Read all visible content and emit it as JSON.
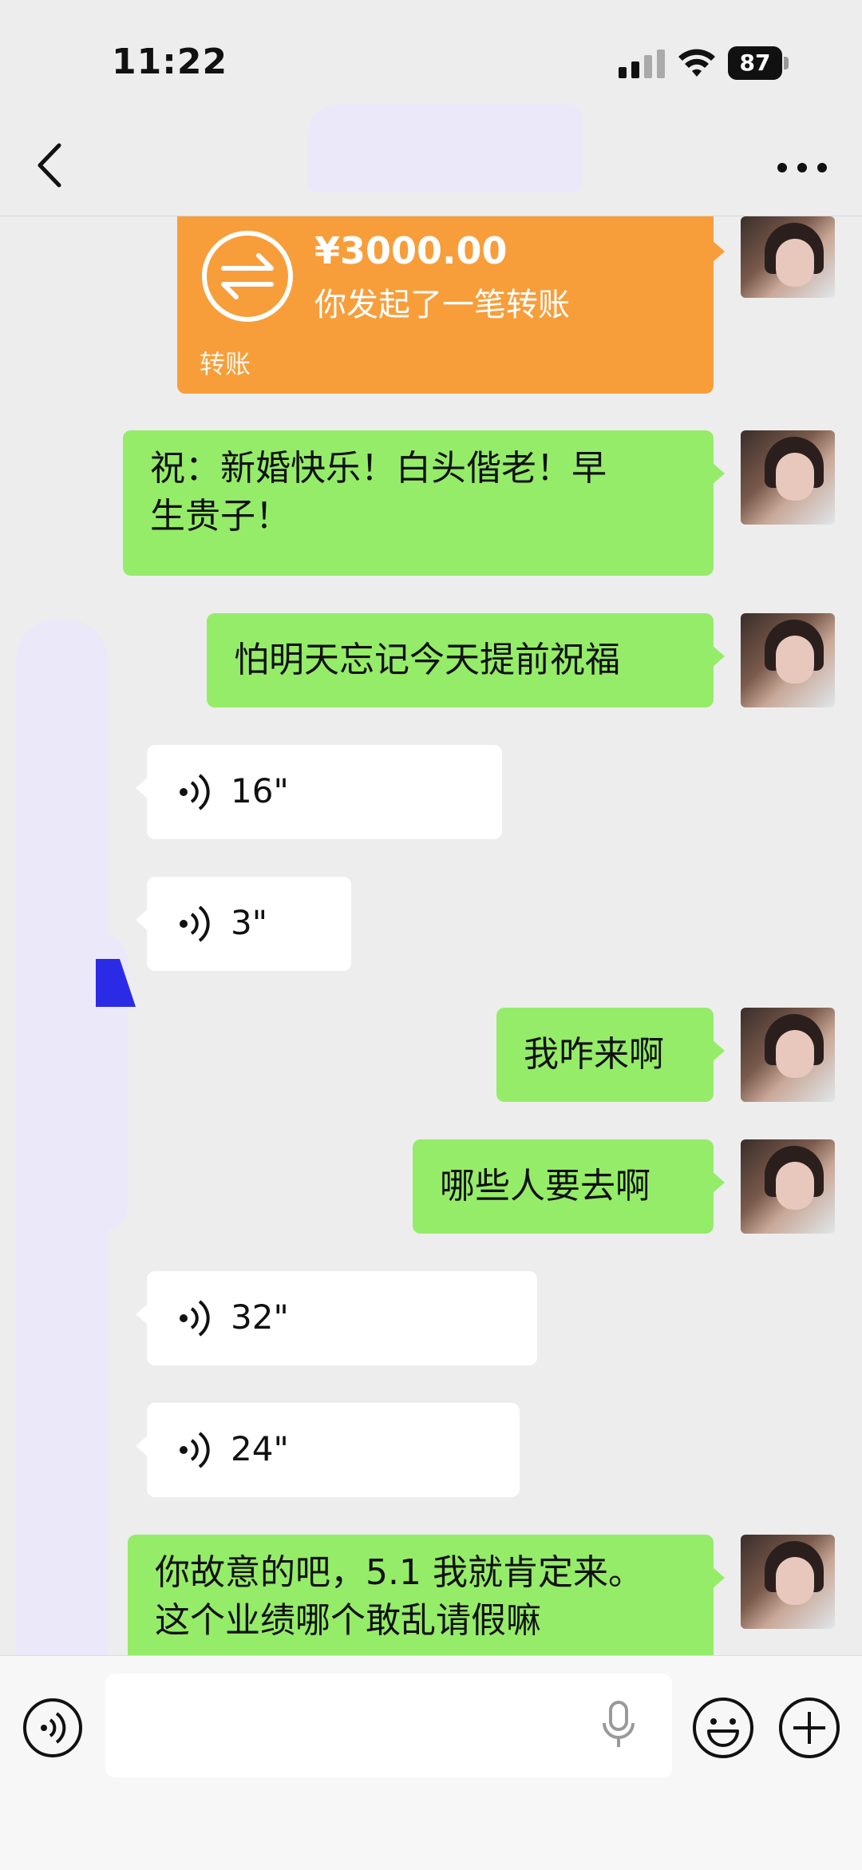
{
  "status_bar": {
    "time": "11:22",
    "battery": "87"
  },
  "nav": {
    "back_icon": "chevron-left-icon",
    "more_icon": "more-dots-icon"
  },
  "messages": [
    {
      "type": "transfer",
      "amount": "¥3000.00",
      "description": "你发起了一笔转账",
      "label": "转账"
    },
    {
      "type": "text",
      "text_line1": "祝：新婚快乐！白头偕老！早",
      "text_line2": "生贵子！"
    },
    {
      "type": "text",
      "text": "怕明天忘记今天提前祝福"
    },
    {
      "type": "voice",
      "duration": "16\""
    },
    {
      "type": "voice",
      "duration": "3\""
    },
    {
      "type": "text",
      "text": "我咋来啊"
    },
    {
      "type": "text",
      "text": "哪些人要去啊"
    },
    {
      "type": "voice",
      "duration": "32\""
    },
    {
      "type": "voice",
      "duration": "24\""
    },
    {
      "type": "text",
      "text_line1": "你故意的吧，5.1 我就肯定来。",
      "text_line2": "这个业绩哪个敢乱请假嘛"
    }
  ],
  "input_bar": {
    "voice_toggle_icon": "voice-mode-icon",
    "mic_icon": "microphone-icon",
    "emoji_icon": "emoji-icon",
    "plus_icon": "plus-icon"
  },
  "colors": {
    "sent_bubble": "#95ec69",
    "transfer_bubble": "#f79e3a",
    "background": "#ededed"
  }
}
